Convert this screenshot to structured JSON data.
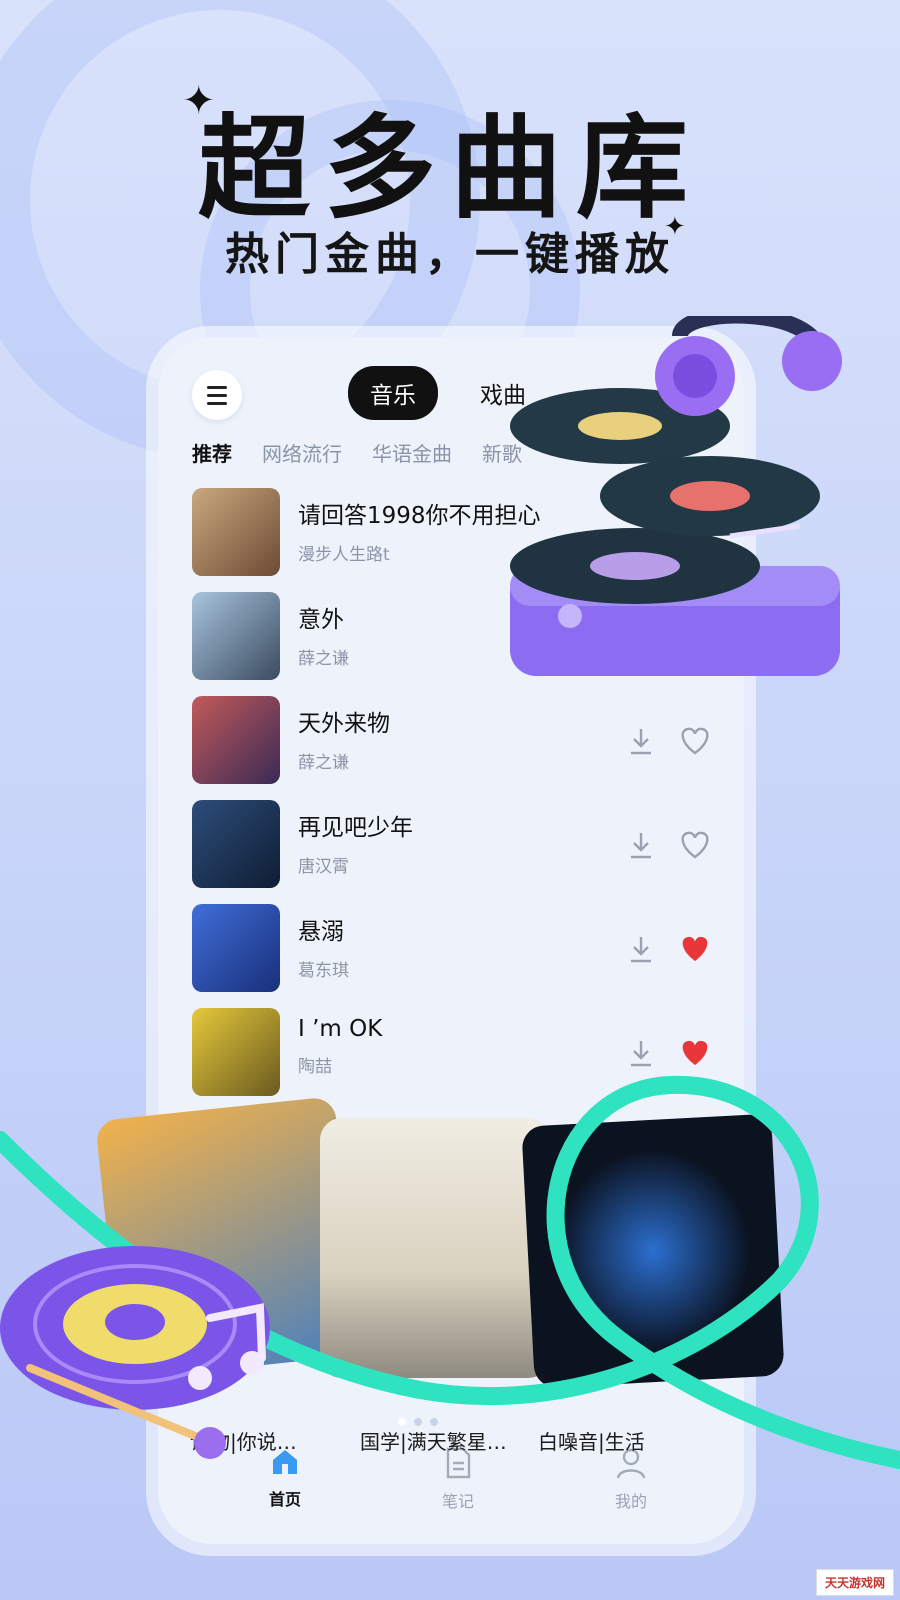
{
  "promo": {
    "headline": "超多曲库",
    "subheadline": "热门金曲，一键播放"
  },
  "app": {
    "top_tabs": [
      {
        "label": "音乐",
        "active": true
      },
      {
        "label": "戏曲",
        "active": false
      }
    ],
    "category_tabs": [
      {
        "label": "推荐",
        "active": true
      },
      {
        "label": "网络流行",
        "active": false
      },
      {
        "label": "华语金曲",
        "active": false
      },
      {
        "label": "新歌",
        "active": false
      }
    ],
    "songs": [
      {
        "title": "请回答1998你不用担心",
        "artist": "漫步人生路t",
        "liked": false,
        "cover_colors": [
          "#c9a97e",
          "#6c4a35"
        ]
      },
      {
        "title": "意外",
        "artist": "薛之谦",
        "liked": false,
        "cover_colors": [
          "#a8c4dd",
          "#3b4b60"
        ]
      },
      {
        "title": "天外来物",
        "artist": "薛之谦",
        "liked": false,
        "cover_colors": [
          "#c25a5a",
          "#3a2a55"
        ]
      },
      {
        "title": "再见吧少年",
        "artist": "唐汉霄",
        "liked": false,
        "cover_colors": [
          "#2d4d7a",
          "#0f1d33"
        ]
      },
      {
        "title": "悬溺",
        "artist": "葛东琪",
        "liked": true,
        "cover_colors": [
          "#3f6ed8",
          "#1a2f7a"
        ]
      },
      {
        "title": "I ’m OK",
        "artist": "陶喆",
        "liked": true,
        "cover_colors": [
          "#e5c93a",
          "#6a5a20"
        ]
      }
    ],
    "playlist_cards": [
      {
        "label": "读物|你说…",
        "colors": [
          "#f2b24a",
          "#4a7fbf"
        ]
      },
      {
        "label": "国学|满天繁星…",
        "colors": [
          "#e8e2d4",
          "#8f8a80"
        ]
      },
      {
        "label": "白噪音|生活",
        "colors": [
          "#0b1220",
          "#2c6fd0"
        ]
      }
    ],
    "nav": [
      {
        "label": "首页",
        "icon": "home-icon",
        "active": true
      },
      {
        "label": "笔记",
        "icon": "note-icon",
        "active": false
      },
      {
        "label": "我的",
        "icon": "profile-icon",
        "active": false
      }
    ],
    "colors": {
      "accent_turquoise": "#2fe3c0",
      "like_red": "#e8363b",
      "vinyl_purple": "#8c6cf0"
    }
  },
  "watermark": "天天游戏网"
}
